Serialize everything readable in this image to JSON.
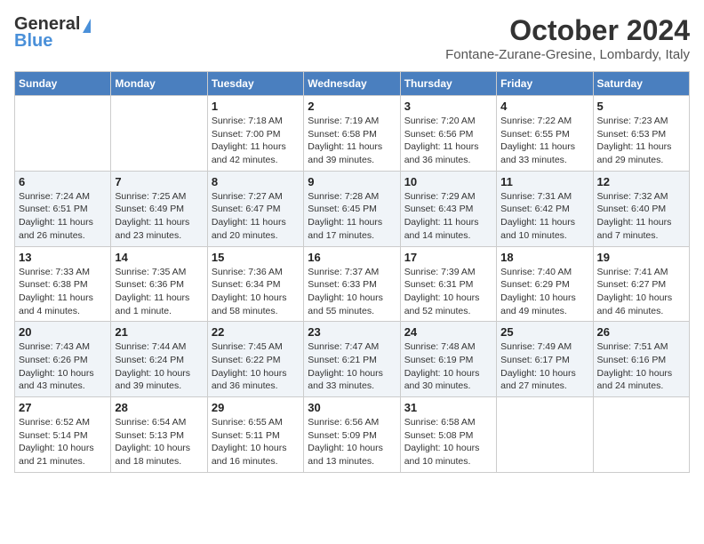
{
  "header": {
    "logo_general": "General",
    "logo_blue": "Blue",
    "month": "October 2024",
    "location": "Fontane-Zurane-Gresine, Lombardy, Italy"
  },
  "days_of_week": [
    "Sunday",
    "Monday",
    "Tuesday",
    "Wednesday",
    "Thursday",
    "Friday",
    "Saturday"
  ],
  "weeks": [
    [
      {
        "day": "",
        "info": ""
      },
      {
        "day": "",
        "info": ""
      },
      {
        "day": "1",
        "info": "Sunrise: 7:18 AM\nSunset: 7:00 PM\nDaylight: 11 hours and 42 minutes."
      },
      {
        "day": "2",
        "info": "Sunrise: 7:19 AM\nSunset: 6:58 PM\nDaylight: 11 hours and 39 minutes."
      },
      {
        "day": "3",
        "info": "Sunrise: 7:20 AM\nSunset: 6:56 PM\nDaylight: 11 hours and 36 minutes."
      },
      {
        "day": "4",
        "info": "Sunrise: 7:22 AM\nSunset: 6:55 PM\nDaylight: 11 hours and 33 minutes."
      },
      {
        "day": "5",
        "info": "Sunrise: 7:23 AM\nSunset: 6:53 PM\nDaylight: 11 hours and 29 minutes."
      }
    ],
    [
      {
        "day": "6",
        "info": "Sunrise: 7:24 AM\nSunset: 6:51 PM\nDaylight: 11 hours and 26 minutes."
      },
      {
        "day": "7",
        "info": "Sunrise: 7:25 AM\nSunset: 6:49 PM\nDaylight: 11 hours and 23 minutes."
      },
      {
        "day": "8",
        "info": "Sunrise: 7:27 AM\nSunset: 6:47 PM\nDaylight: 11 hours and 20 minutes."
      },
      {
        "day": "9",
        "info": "Sunrise: 7:28 AM\nSunset: 6:45 PM\nDaylight: 11 hours and 17 minutes."
      },
      {
        "day": "10",
        "info": "Sunrise: 7:29 AM\nSunset: 6:43 PM\nDaylight: 11 hours and 14 minutes."
      },
      {
        "day": "11",
        "info": "Sunrise: 7:31 AM\nSunset: 6:42 PM\nDaylight: 11 hours and 10 minutes."
      },
      {
        "day": "12",
        "info": "Sunrise: 7:32 AM\nSunset: 6:40 PM\nDaylight: 11 hours and 7 minutes."
      }
    ],
    [
      {
        "day": "13",
        "info": "Sunrise: 7:33 AM\nSunset: 6:38 PM\nDaylight: 11 hours and 4 minutes."
      },
      {
        "day": "14",
        "info": "Sunrise: 7:35 AM\nSunset: 6:36 PM\nDaylight: 11 hours and 1 minute."
      },
      {
        "day": "15",
        "info": "Sunrise: 7:36 AM\nSunset: 6:34 PM\nDaylight: 10 hours and 58 minutes."
      },
      {
        "day": "16",
        "info": "Sunrise: 7:37 AM\nSunset: 6:33 PM\nDaylight: 10 hours and 55 minutes."
      },
      {
        "day": "17",
        "info": "Sunrise: 7:39 AM\nSunset: 6:31 PM\nDaylight: 10 hours and 52 minutes."
      },
      {
        "day": "18",
        "info": "Sunrise: 7:40 AM\nSunset: 6:29 PM\nDaylight: 10 hours and 49 minutes."
      },
      {
        "day": "19",
        "info": "Sunrise: 7:41 AM\nSunset: 6:27 PM\nDaylight: 10 hours and 46 minutes."
      }
    ],
    [
      {
        "day": "20",
        "info": "Sunrise: 7:43 AM\nSunset: 6:26 PM\nDaylight: 10 hours and 43 minutes."
      },
      {
        "day": "21",
        "info": "Sunrise: 7:44 AM\nSunset: 6:24 PM\nDaylight: 10 hours and 39 minutes."
      },
      {
        "day": "22",
        "info": "Sunrise: 7:45 AM\nSunset: 6:22 PM\nDaylight: 10 hours and 36 minutes."
      },
      {
        "day": "23",
        "info": "Sunrise: 7:47 AM\nSunset: 6:21 PM\nDaylight: 10 hours and 33 minutes."
      },
      {
        "day": "24",
        "info": "Sunrise: 7:48 AM\nSunset: 6:19 PM\nDaylight: 10 hours and 30 minutes."
      },
      {
        "day": "25",
        "info": "Sunrise: 7:49 AM\nSunset: 6:17 PM\nDaylight: 10 hours and 27 minutes."
      },
      {
        "day": "26",
        "info": "Sunrise: 7:51 AM\nSunset: 6:16 PM\nDaylight: 10 hours and 24 minutes."
      }
    ],
    [
      {
        "day": "27",
        "info": "Sunrise: 6:52 AM\nSunset: 5:14 PM\nDaylight: 10 hours and 21 minutes."
      },
      {
        "day": "28",
        "info": "Sunrise: 6:54 AM\nSunset: 5:13 PM\nDaylight: 10 hours and 18 minutes."
      },
      {
        "day": "29",
        "info": "Sunrise: 6:55 AM\nSunset: 5:11 PM\nDaylight: 10 hours and 16 minutes."
      },
      {
        "day": "30",
        "info": "Sunrise: 6:56 AM\nSunset: 5:09 PM\nDaylight: 10 hours and 13 minutes."
      },
      {
        "day": "31",
        "info": "Sunrise: 6:58 AM\nSunset: 5:08 PM\nDaylight: 10 hours and 10 minutes."
      },
      {
        "day": "",
        "info": ""
      },
      {
        "day": "",
        "info": ""
      }
    ]
  ]
}
